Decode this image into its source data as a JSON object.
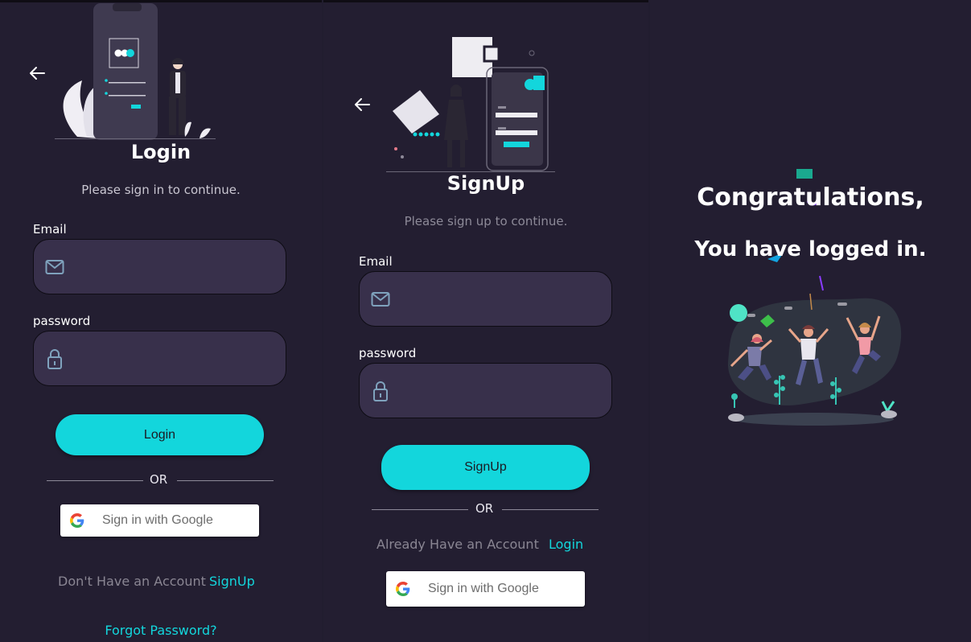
{
  "login": {
    "title": "Login",
    "subtitle": "Please sign in to continue.",
    "email_label": "Email",
    "email_value": "",
    "password_label": "password",
    "password_value": "",
    "submit_label": "Login",
    "or_label": "OR",
    "google_label": "Sign in with Google",
    "no_account_text": "Don't Have an Account",
    "signup_link": "SignUp",
    "forgot_link": "Forgot Password?"
  },
  "signup": {
    "title": "SignUp",
    "subtitle": "Please sign up to continue.",
    "email_label": "Email",
    "email_value": "",
    "password_label": "password",
    "password_value": "",
    "submit_label": "SignUp",
    "or_label": "OR",
    "have_account_text": "Already Have an Account",
    "login_link": "Login",
    "google_label": "Sign in with Google"
  },
  "success": {
    "line1": "Congratulations,",
    "line2": "You have logged in."
  },
  "icons": {
    "back": "arrow-left-icon",
    "email": "envelope-icon",
    "password": "lock-icon",
    "google": "google-logo-icon"
  },
  "colors": {
    "background": "#231e31",
    "field": "#38304b",
    "accent": "#13d6dc",
    "text": "#ffffff",
    "muted": "#8a8693"
  }
}
